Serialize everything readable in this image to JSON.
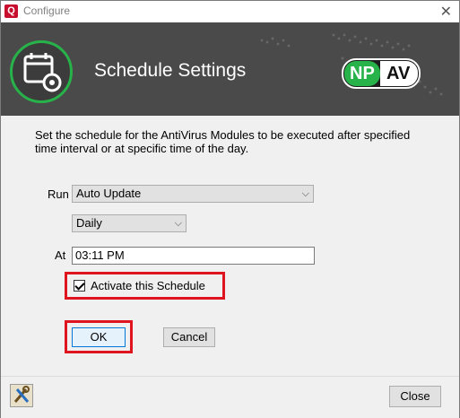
{
  "window": {
    "title": "Configure",
    "app_icon_glyph": "Q",
    "close_glyph": "✕"
  },
  "banner": {
    "title": "Schedule Settings",
    "brand_left": "NP",
    "brand_right": "AV",
    "icon": "calendar-gear-icon",
    "accent": "#27b24a"
  },
  "description": "Set the schedule for the AntiVirus Modules to be executed after specified time interval or at specific time of the day.",
  "form": {
    "run_label": "Run",
    "run_value": "Auto Update",
    "frequency_value": "Daily",
    "at_label": "At",
    "time_value": "03:11 PM",
    "activate_label": "Activate this Schedule",
    "activate_checked": true,
    "dropdown_chevron": "⌵"
  },
  "buttons": {
    "ok": "OK",
    "cancel": "Cancel",
    "close": "Close"
  },
  "colors": {
    "highlight": "#e0141e",
    "banner_bg": "#4a4a4a"
  }
}
